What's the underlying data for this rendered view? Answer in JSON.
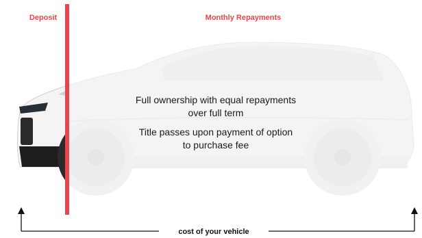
{
  "labels": {
    "deposit": "Deposit",
    "monthly": "Monthly Repayments",
    "cost": "cost of your vehicle"
  },
  "descriptions": {
    "line1a": "Full ownership with equal repayments",
    "line1b": "over full term",
    "line2a": "Title passes upon payment of option",
    "line2b": "to purchase fee"
  },
  "colors": {
    "accent": "#e8454c",
    "text": "#1a1a1a"
  },
  "icons": {
    "vehicle": "suv-car-image",
    "arrow_left": "arrow-up-icon",
    "arrow_right": "arrow-up-icon"
  }
}
